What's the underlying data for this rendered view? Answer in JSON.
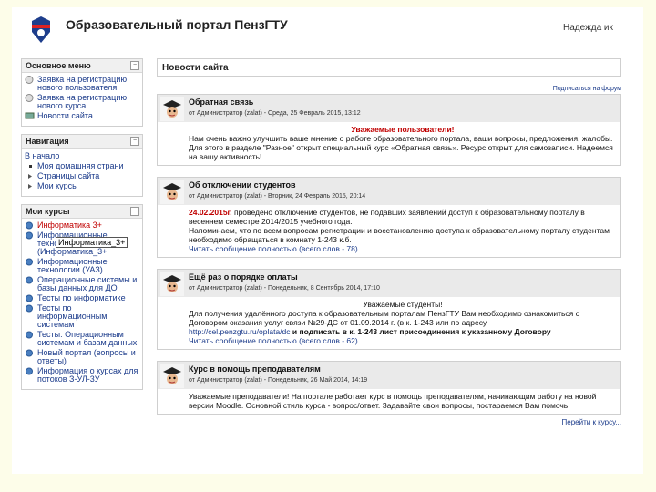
{
  "header": {
    "title": "Образовательный портал ПензГТУ",
    "user_link": "Надежда ик"
  },
  "sidebar": {
    "main_menu": {
      "title": "Основное меню",
      "items": [
        {
          "label": "Заявка на регистрацию нового пользователя",
          "icon": "document-icon"
        },
        {
          "label": "Заявка на регистрацию нового курса",
          "icon": "document-icon"
        },
        {
          "label": "Новости сайта",
          "icon": "forum-icon"
        }
      ]
    },
    "navigation": {
      "title": "Навигация",
      "start": "В начало",
      "items": [
        {
          "label": "Моя домашняя страни"
        },
        {
          "label": "Страницы сайта"
        },
        {
          "label": "Мои курсы"
        }
      ]
    },
    "my_courses": {
      "title": "Мои курсы",
      "items": [
        {
          "label": "Информатика 3+",
          "red": true
        },
        {
          "label": "Информационные технологии (Информатика_3+",
          "red": false
        },
        {
          "label": "Информационные технологии (УАЗ)",
          "red": false
        },
        {
          "label": "Операционные системы и базы данных для ДО",
          "red": false
        },
        {
          "label": "Тесты по информатике",
          "red": false
        },
        {
          "label": "Тесты по информационным системам",
          "red": false
        },
        {
          "label": "Тесты: Операционным системам и базам данных",
          "red": false
        },
        {
          "label": "Новый портал (вопросы и ответы)",
          "red": false
        },
        {
          "label": "Информация о курсах для потоков З-УЛ-3У",
          "red": false
        }
      ],
      "tooltip": "Информатика_3+"
    }
  },
  "main": {
    "title": "Новости сайта",
    "subscribe": "Подписаться на форум",
    "more": "Перейти к курсу...",
    "posts": [
      {
        "subject": "Обратная связь",
        "meta": "от Администратор (zalat) - Среда, 25 Февраль 2015, 13:12",
        "heading": "Уважаемые пользователи!",
        "body": "Нам очень важно улучшить ваше мнение о работе образовательного портала, ваши вопросы, предложения, жалобы. Для этого в разделе \"Разное\" открыт специальный курс «Обратная связь». Ресурс открыт для самозаписи. Надеемся на вашу активность!"
      },
      {
        "subject": "Об отключении студентов",
        "meta": "от Администратор (zalat) - Вторник, 24 Февраль 2015, 20:14",
        "date": "24.02.2015г.",
        "body1": "проведено отключение студентов, не подавших заявлений доступ к образовательному порталу в весеннем семестре 2014/2015 учебного года.",
        "body2": "Напоминаем, что по всем вопросам регистрации и восстановлению доступа к образовательному порталу студентам необходимо обращаться в комнату 1-243 к.б.",
        "link": "Читать сообщение полностью (всего слов - 78)"
      },
      {
        "subject": "Ещё раз о порядке оплаты",
        "meta": "от Администратор (zalat) - Понедельник, 8 Сентябрь 2014, 17:10",
        "heading": "Уважаемые студенты!",
        "body": "Для получения удалённого доступа к образовательным порталам ПензГТУ Вам необходимо ознакомиться с Договором оказания услуг связи №29-ДС от 01.09.2014 г. (в к. 1-243 или по адресу",
        "link1": "http://cel.penzgtu.ru/oplata/dc",
        "bold": "и подписать в к. 1-243 лист присоединения к указанному Договору",
        "link2": "Читать сообщение полностью (всего слов - 62)"
      },
      {
        "subject": "Курс в помощь преподавателям",
        "meta": "от Администратор (zalat) - Понедельник, 26 Май 2014, 14:19",
        "body": "Уважаемые преподаватели! На портале работает курс в помощь преподавателям, начинающим работу на новой версии Moodle. Основной стиль курса - вопрос/ответ. Задавайте свои вопросы, постараемся Вам помочь."
      }
    ]
  }
}
